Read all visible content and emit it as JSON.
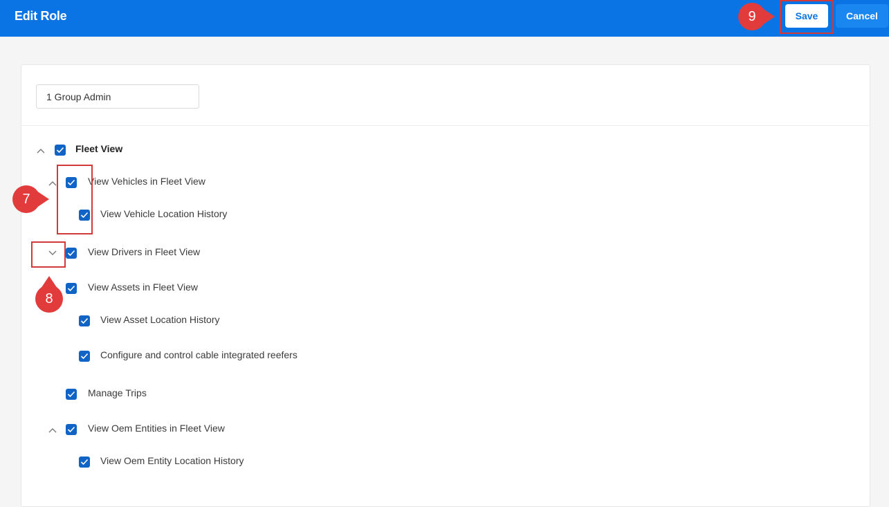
{
  "header": {
    "title": "Edit Role",
    "save_label": "Save",
    "cancel_label": "Cancel"
  },
  "form": {
    "role_name": "1 Group Admin"
  },
  "permissions": {
    "fleet_view": "Fleet View",
    "view_vehicles": "View Vehicles in Fleet View",
    "view_vehicle_location_history": "View Vehicle Location History",
    "view_drivers": "View Drivers in Fleet View",
    "view_assets": "View Assets in Fleet View",
    "view_asset_location_history": "View Asset Location History",
    "configure_reefers": "Configure and control cable integrated reefers",
    "manage_trips": "Manage Trips",
    "view_oem_entities": "View Oem Entities in Fleet View",
    "view_oem_entity_location_history": "View Oem Entity Location History"
  },
  "annotations": {
    "step_7": "7",
    "step_8": "8",
    "step_9": "9"
  },
  "colors": {
    "header_bg": "#0b74e5",
    "checkbox": "#1064c6",
    "annotation": "#e23b3b"
  }
}
